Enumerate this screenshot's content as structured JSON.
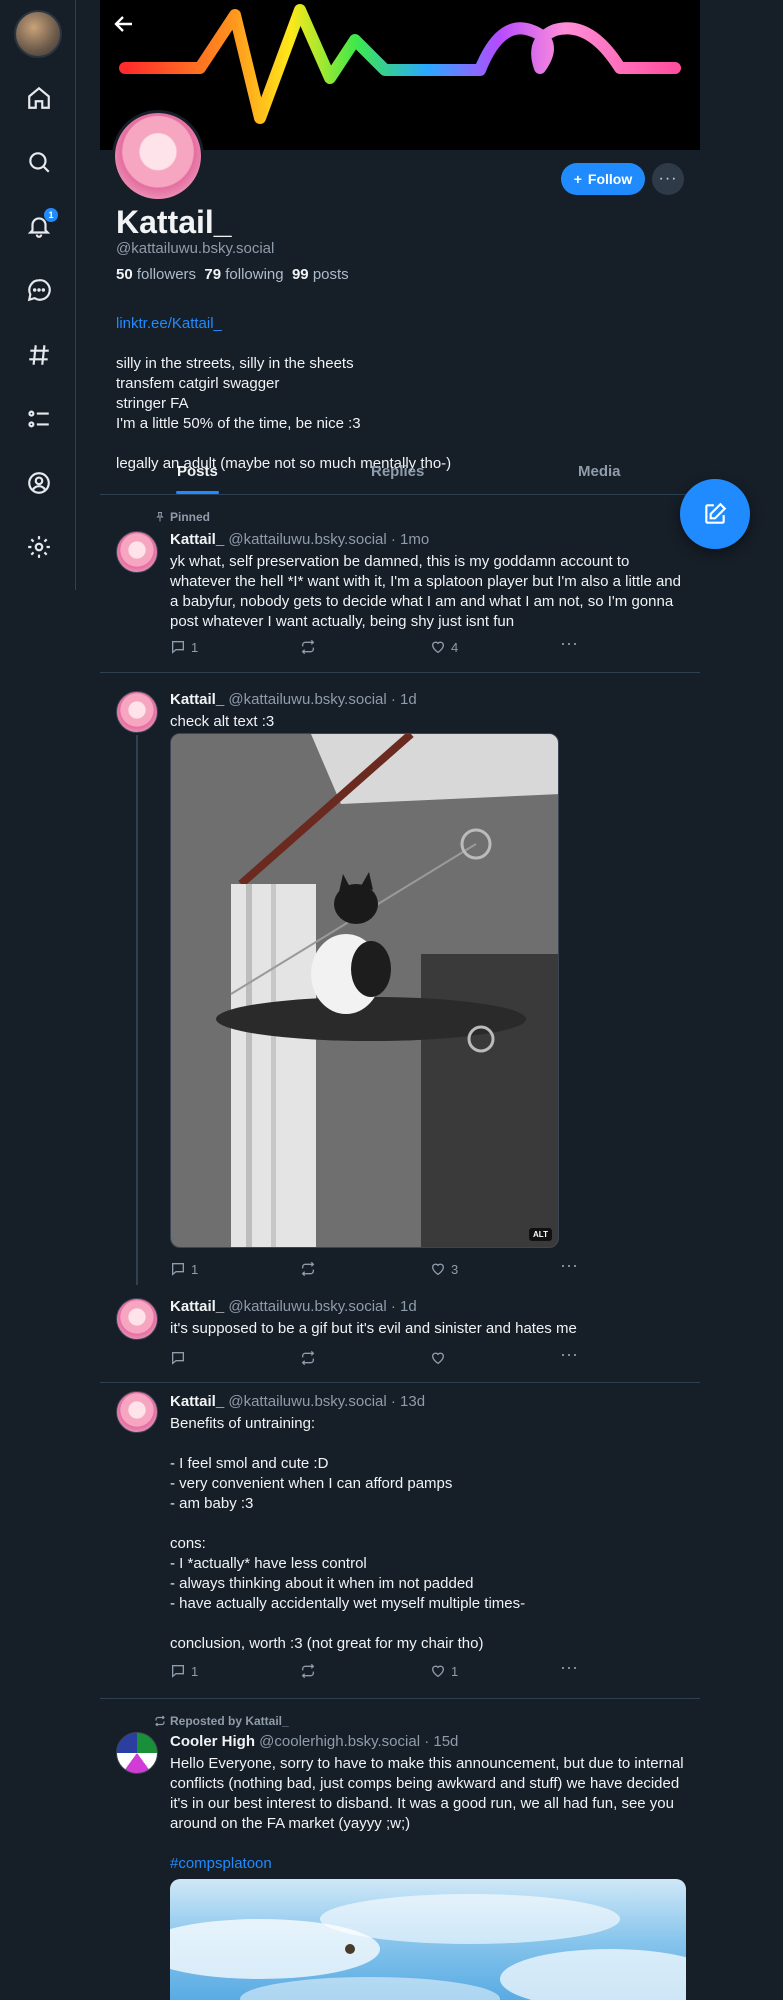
{
  "nav": {
    "notification_count": "1"
  },
  "profile": {
    "display_name": "Kattail_",
    "handle": "@kattailuwu.bsky.social",
    "followers_count": "50",
    "followers_label": "followers",
    "following_count": "79",
    "following_label": "following",
    "posts_count": "99",
    "posts_label": "posts",
    "link": "linktr.ee/Kattail_",
    "bio": "silly in the streets, silly in the sheets\ntransfem catgirl swagger\nstringer FA\nI'm a little 50% of the time, be nice :3\n\nlegally an adult (maybe not so much mentally tho-)",
    "follow_label": "Follow",
    "more_label": "···"
  },
  "tabs": [
    "Posts",
    "Replies",
    "Media"
  ],
  "colors": {
    "accent": "#208bfe",
    "background": "#161e27",
    "border": "#2e4052"
  },
  "posts": [
    {
      "context": "Pinned",
      "author": "Kattail_",
      "handle": "@kattailuwu.bsky.social",
      "time": "· 1mo",
      "text": "yk what, self preservation be damned, this is my goddamn account to whatever the hell *I* want with it, I'm a splatoon player but I'm also a little and a babyfur, nobody gets to decide what I am and what I am not, so I'm gonna post whatever I want actually, being shy just isnt fun",
      "replies": "1",
      "reposts": "",
      "likes": "4"
    },
    {
      "author": "Kattail_",
      "handle": "@kattailuwu.bsky.social",
      "time": "· 1d",
      "text": "check alt text :3",
      "alt_badge": "ALT",
      "replies": "1",
      "reposts": "",
      "likes": "3"
    },
    {
      "author": "Kattail_",
      "handle": "@kattailuwu.bsky.social",
      "time": "· 1d",
      "text": "it's supposed to be a gif but it's evil and sinister and hates me",
      "replies": "",
      "reposts": "",
      "likes": ""
    },
    {
      "author": "Kattail_",
      "handle": "@kattailuwu.bsky.social",
      "time": "· 13d",
      "text": "Benefits of untraining:\n\n- I feel smol and cute :D\n- very convenient when I can afford pamps\n- am baby :3\n\ncons:\n- I *actually* have less control\n- always thinking about it when im not padded\n- have actually accidentally wet myself multiple times-\n\nconclusion, worth :3 (not great for my chair tho)",
      "replies": "1",
      "reposts": "",
      "likes": "1"
    },
    {
      "context": "Reposted by Kattail_",
      "author": "Cooler High",
      "handle": "@coolerhigh.bsky.social",
      "time": "· 15d",
      "text": "Hello Everyone, sorry to have to make this announcement, but due to internal conflicts (nothing bad, just comps being awkward and stuff) we have decided it's in our best interest to disband. It was a good run, we all had fun, see you around on the FA market (yayyy ;w;)",
      "hashtag": "#compsplatoon"
    }
  ]
}
